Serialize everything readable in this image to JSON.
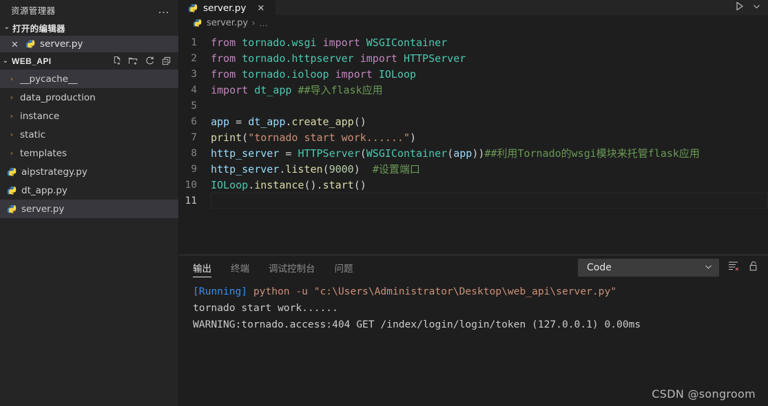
{
  "sidebar": {
    "title": "资源管理器",
    "more_actions": "…",
    "open_editors": {
      "label": "打开的编辑器",
      "twisty": "⌄",
      "items": [
        {
          "name": "server.py",
          "icon": "python-icon",
          "close": "✕",
          "selected": true
        }
      ]
    },
    "workspace": {
      "label": "WEB_API",
      "twisty": "⌄",
      "actions": [
        "new-file-icon",
        "new-folder-icon",
        "refresh-icon",
        "collapse-all-icon"
      ],
      "tree": [
        {
          "label": "__pycache__",
          "type": "folder",
          "chev": "›",
          "selected": true
        },
        {
          "label": "data_production",
          "type": "folder",
          "chev": "›",
          "selected": false
        },
        {
          "label": "instance",
          "type": "folder",
          "chev": "›",
          "selected": false
        },
        {
          "label": "static",
          "type": "folder",
          "chev": "›",
          "selected": false
        },
        {
          "label": "templates",
          "type": "folder",
          "chev": "›",
          "selected": false
        },
        {
          "label": "aipstrategy.py",
          "type": "python",
          "chev": "",
          "selected": false
        },
        {
          "label": "dt_app.py",
          "type": "python",
          "chev": "",
          "selected": false
        },
        {
          "label": "server.py",
          "type": "python",
          "chev": "",
          "selected": true
        }
      ]
    }
  },
  "editor": {
    "tab": {
      "label": "server.py",
      "icon": "python-icon",
      "close": "✕"
    },
    "actions": [
      "run-icon",
      "chevron-down-icon"
    ],
    "breadcrumb": {
      "file": "server.py",
      "sep": "›",
      "dots": "…"
    },
    "current_line": 11,
    "lines": [
      {
        "n": 1,
        "tokens": [
          {
            "t": "kw",
            "v": "from"
          },
          {
            "t": "plain",
            "v": " "
          },
          {
            "t": "mod",
            "v": "tornado.wsgi"
          },
          {
            "t": "plain",
            "v": " "
          },
          {
            "t": "kw",
            "v": "import"
          },
          {
            "t": "plain",
            "v": " "
          },
          {
            "t": "cls",
            "v": "WSGIContainer"
          }
        ]
      },
      {
        "n": 2,
        "tokens": [
          {
            "t": "kw",
            "v": "from"
          },
          {
            "t": "plain",
            "v": " "
          },
          {
            "t": "mod",
            "v": "tornado.httpserver"
          },
          {
            "t": "plain",
            "v": " "
          },
          {
            "t": "kw",
            "v": "import"
          },
          {
            "t": "plain",
            "v": " "
          },
          {
            "t": "cls",
            "v": "HTTPServer"
          }
        ]
      },
      {
        "n": 3,
        "tokens": [
          {
            "t": "kw",
            "v": "from"
          },
          {
            "t": "plain",
            "v": " "
          },
          {
            "t": "mod",
            "v": "tornado.ioloop"
          },
          {
            "t": "plain",
            "v": " "
          },
          {
            "t": "kw",
            "v": "import"
          },
          {
            "t": "plain",
            "v": " "
          },
          {
            "t": "cls",
            "v": "IOLoop"
          }
        ]
      },
      {
        "n": 4,
        "tokens": [
          {
            "t": "kw",
            "v": "import"
          },
          {
            "t": "plain",
            "v": " "
          },
          {
            "t": "mod",
            "v": "dt_app"
          },
          {
            "t": "plain",
            "v": " "
          },
          {
            "t": "cmt",
            "v": "##导入flask应用"
          }
        ]
      },
      {
        "n": 5,
        "tokens": []
      },
      {
        "n": 6,
        "tokens": [
          {
            "t": "var",
            "v": "app"
          },
          {
            "t": "plain",
            "v": " = "
          },
          {
            "t": "var",
            "v": "dt_app"
          },
          {
            "t": "plain",
            "v": "."
          },
          {
            "t": "fn",
            "v": "create_app"
          },
          {
            "t": "plain",
            "v": "()"
          }
        ]
      },
      {
        "n": 7,
        "tokens": [
          {
            "t": "fn",
            "v": "print"
          },
          {
            "t": "plain",
            "v": "("
          },
          {
            "t": "str",
            "v": "\"tornado start work......\""
          },
          {
            "t": "plain",
            "v": ")"
          }
        ]
      },
      {
        "n": 8,
        "tokens": [
          {
            "t": "var",
            "v": "http_server"
          },
          {
            "t": "plain",
            "v": " = "
          },
          {
            "t": "cls",
            "v": "HTTPServer"
          },
          {
            "t": "plain",
            "v": "("
          },
          {
            "t": "cls",
            "v": "WSGIContainer"
          },
          {
            "t": "plain",
            "v": "("
          },
          {
            "t": "var",
            "v": "app"
          },
          {
            "t": "plain",
            "v": "))"
          },
          {
            "t": "cmt",
            "v": "##利用Tornado的wsgi模块来托管flask应用"
          }
        ]
      },
      {
        "n": 9,
        "tokens": [
          {
            "t": "var",
            "v": "http_server"
          },
          {
            "t": "plain",
            "v": "."
          },
          {
            "t": "fn",
            "v": "listen"
          },
          {
            "t": "plain",
            "v": "("
          },
          {
            "t": "num",
            "v": "9000"
          },
          {
            "t": "plain",
            "v": ")  "
          },
          {
            "t": "cmt",
            "v": "#设置端口"
          }
        ]
      },
      {
        "n": 10,
        "tokens": [
          {
            "t": "cls",
            "v": "IOLoop"
          },
          {
            "t": "plain",
            "v": "."
          },
          {
            "t": "fn",
            "v": "instance"
          },
          {
            "t": "plain",
            "v": "()."
          },
          {
            "t": "fn",
            "v": "start"
          },
          {
            "t": "plain",
            "v": "()"
          }
        ]
      },
      {
        "n": 11,
        "tokens": []
      }
    ]
  },
  "panel": {
    "tabs": [
      {
        "label": "输出",
        "active": true
      },
      {
        "label": "终端",
        "active": false
      },
      {
        "label": "调试控制台",
        "active": false
      },
      {
        "label": "问题",
        "active": false
      }
    ],
    "output_channel": {
      "value": "Code",
      "chevron": "⌄"
    },
    "actions": [
      "clear-output-icon",
      "unlock-icon"
    ],
    "console": [
      {
        "segments": [
          {
            "c": "blue",
            "v": "[Running]"
          },
          {
            "c": "white",
            "v": " "
          },
          {
            "c": "orange",
            "v": "python -u \"c:\\Users\\Administrator\\Desktop\\web_api\\server.py\""
          }
        ]
      },
      {
        "segments": [
          {
            "c": "white",
            "v": "tornado start work......"
          }
        ]
      },
      {
        "segments": [
          {
            "c": "white",
            "v": "WARNING:tornado.access:404 GET /index/login/login/token (127.0.0.1) 0.00ms"
          }
        ]
      }
    ]
  },
  "watermark": "CSDN @songroom",
  "colors": {
    "sidebar_bg": "#252526",
    "editor_bg": "#1e1e1e",
    "selection_bg": "#37373d",
    "accent_blue": "#3b8eea",
    "keyword": "#c586c0",
    "class": "#4ec9b0",
    "string": "#ce9178",
    "comment": "#6a9955",
    "function": "#dcdcaa",
    "variable": "#9cdcfe",
    "number": "#b5cea8"
  }
}
